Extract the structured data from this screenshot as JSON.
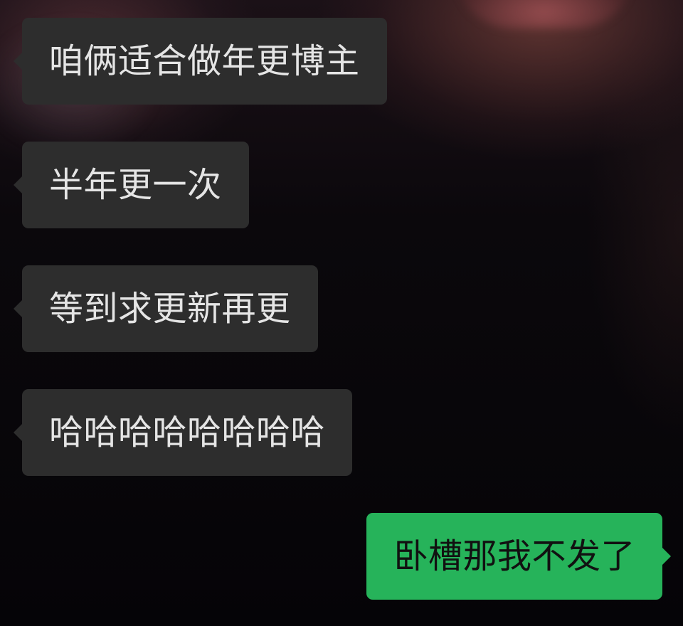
{
  "chat": {
    "messages": [
      {
        "direction": "incoming",
        "text": "咱俩适合做年更博主"
      },
      {
        "direction": "incoming",
        "text": "半年更一次"
      },
      {
        "direction": "incoming",
        "text": "等到求更新再更"
      },
      {
        "direction": "incoming",
        "text": "哈哈哈哈哈哈哈哈"
      },
      {
        "direction": "outgoing",
        "text": "卧槽那我不发了"
      }
    ]
  },
  "colors": {
    "incoming_bubble": "#2d2d2d",
    "incoming_text": "#e5e5e5",
    "outgoing_bubble": "#26b35a",
    "outgoing_text": "#111111",
    "background": "#050407"
  }
}
